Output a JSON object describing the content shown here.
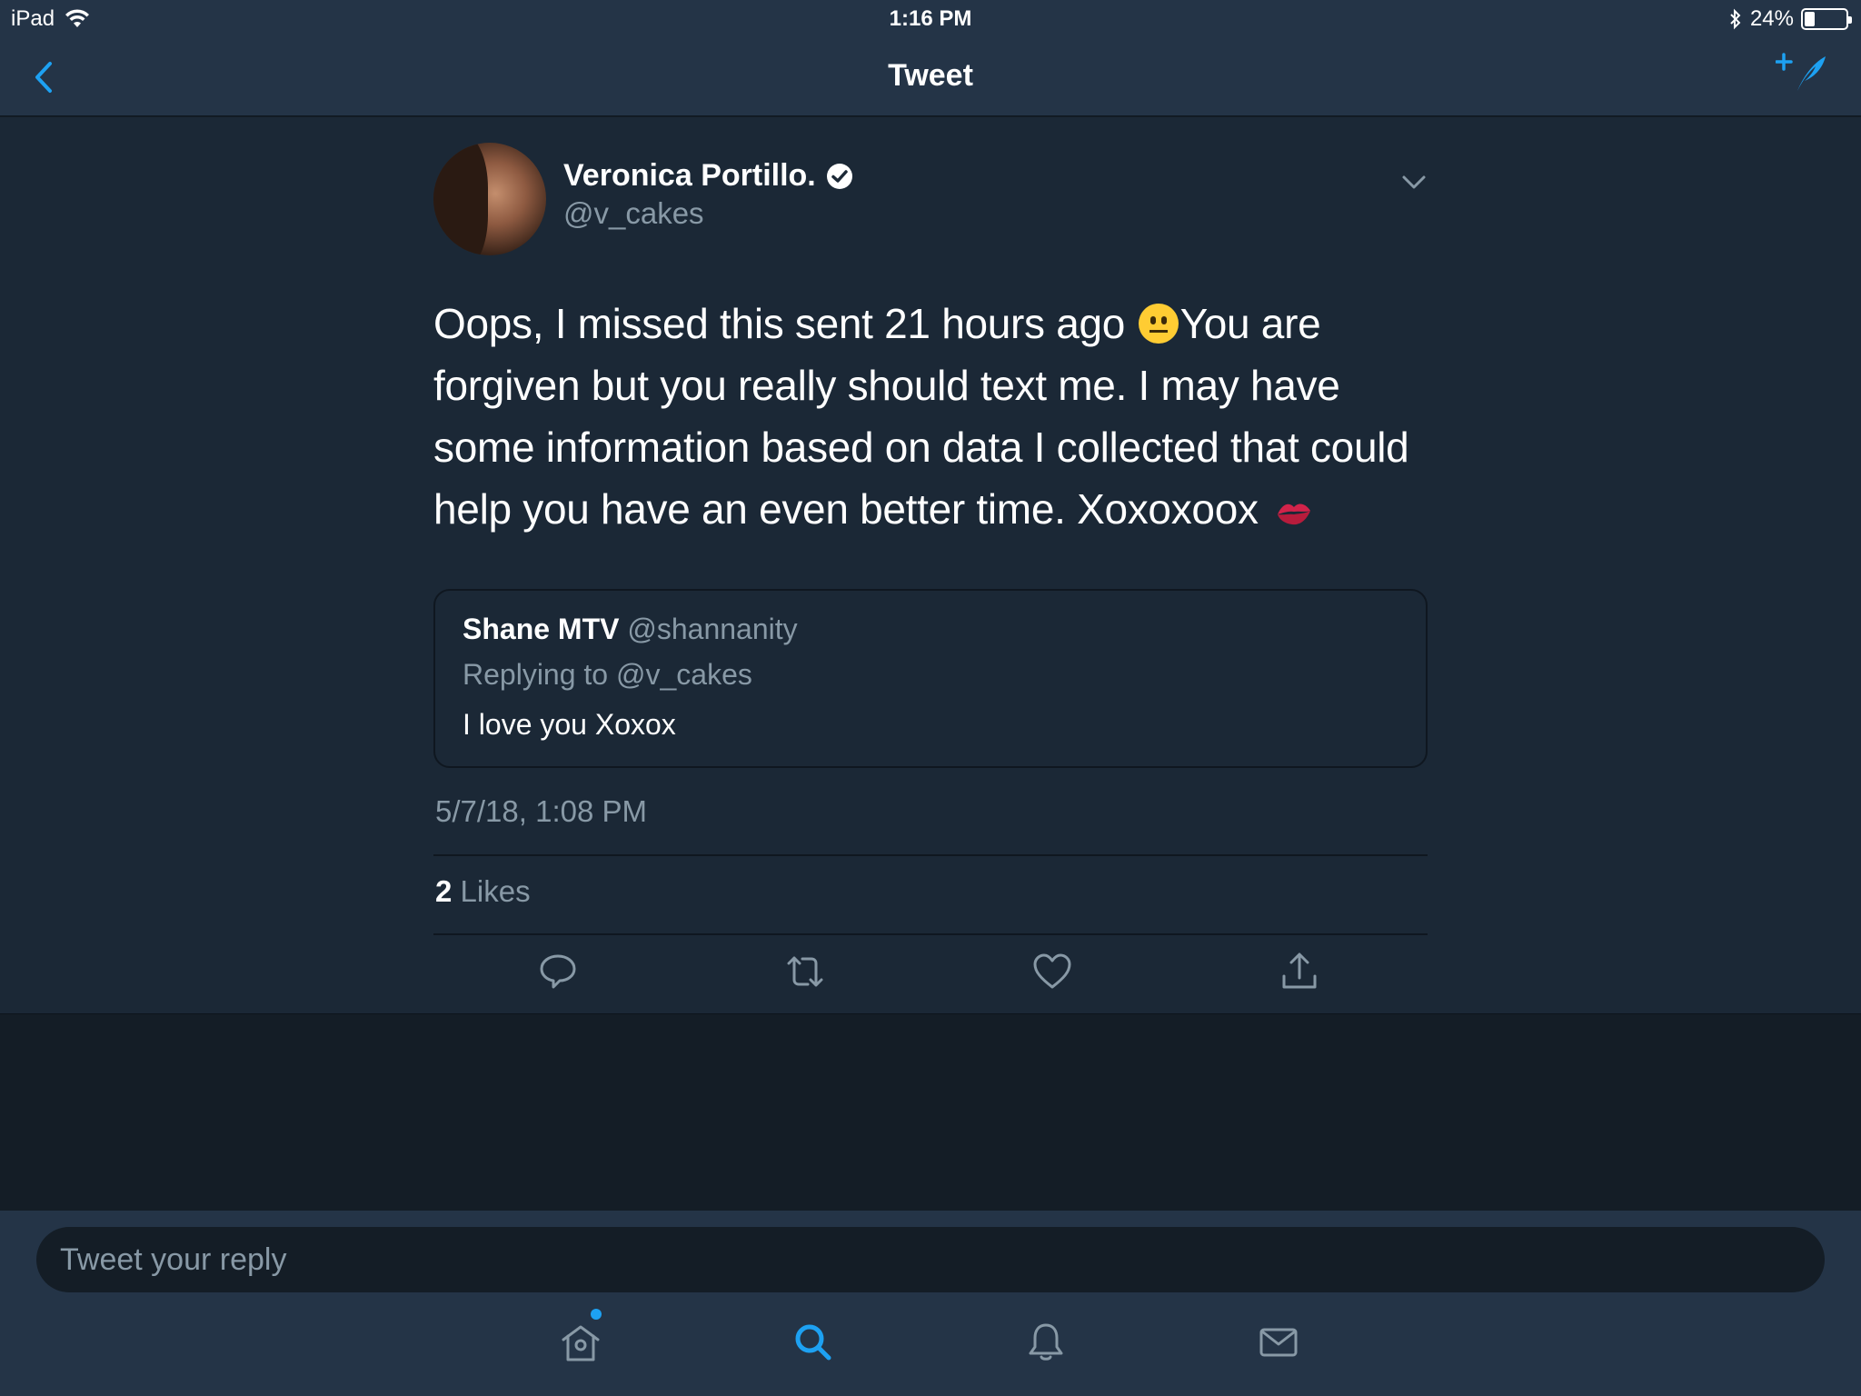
{
  "status_bar": {
    "device": "iPad",
    "time": "1:16 PM",
    "battery_percent": "24%",
    "battery_level": 0.24
  },
  "nav": {
    "title": "Tweet"
  },
  "tweet": {
    "author_name": "Veronica Portillo.",
    "author_handle": "@v_cakes",
    "text_part1": "Oops, I missed this sent 21 hours ago ",
    "text_part2": "You are forgiven but you really should text me.  I may have some information based on data I collected that could help you have an even better time.  Xoxoxoox",
    "timestamp": "5/7/18, 1:08 PM",
    "likes_count": "2",
    "likes_label": "Likes"
  },
  "quoted_tweet": {
    "author_name": "Shane MTV",
    "author_handle": "@shannanity",
    "replying_to": "Replying to @v_cakes",
    "text": "I love you Xoxox"
  },
  "reply_bar": {
    "placeholder": "Tweet your reply"
  },
  "colors": {
    "accent": "#1da1f2",
    "background": "#141d26",
    "panel": "#1b2836",
    "bar": "#243447",
    "secondary_text": "#8899a6"
  },
  "icons": {
    "back": "chevron-left-icon",
    "compose": "compose-tweet-icon",
    "reply": "reply-icon",
    "retweet": "retweet-icon",
    "like": "heart-icon",
    "share": "share-icon",
    "home": "home-icon",
    "search": "search-icon",
    "notifications": "bell-icon",
    "messages": "envelope-icon"
  }
}
